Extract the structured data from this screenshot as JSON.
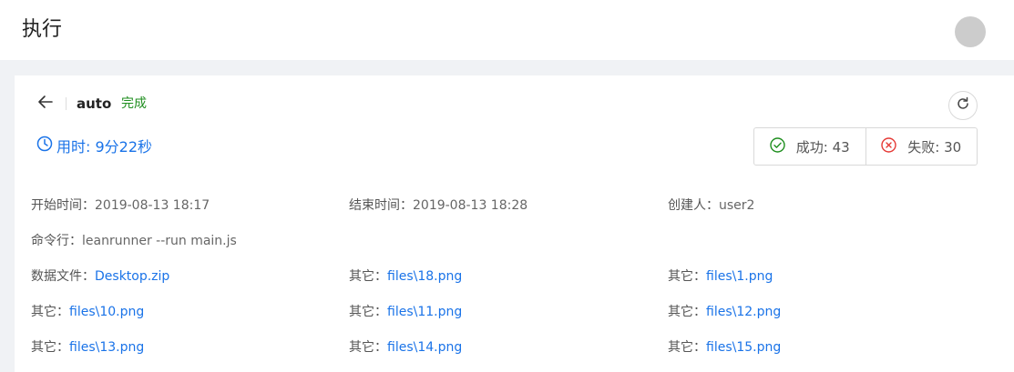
{
  "header": {
    "title": "执行"
  },
  "job": {
    "name": "auto",
    "status": "完成",
    "duration": "用时: 9分22秒",
    "success_label": "成功: 43",
    "fail_label": "失败: 30"
  },
  "info": {
    "start_label": "开始时间：",
    "start_value": "2019-08-13 18:17",
    "end_label": "结束时间：",
    "end_value": "2019-08-13 18:28",
    "creator_label": "创建人：",
    "creator_value": "user2",
    "command_label": "命令行：",
    "command_value": "leanrunner --run main.js",
    "datafile_label": "数据文件：",
    "datafile_value": "Desktop.zip",
    "other_label": "其它：",
    "files": [
      "files\\18.png",
      "files\\1.png",
      "files\\10.png",
      "files\\11.png",
      "files\\12.png",
      "files\\13.png",
      "files\\14.png",
      "files\\15.png"
    ]
  },
  "colors": {
    "link": "#1a73e8",
    "success": "#1e8e1e",
    "fail": "#e53935"
  },
  "icons": [
    "back-arrow-icon",
    "refresh-icon",
    "clock-icon",
    "check-circle-icon",
    "x-circle-icon"
  ]
}
